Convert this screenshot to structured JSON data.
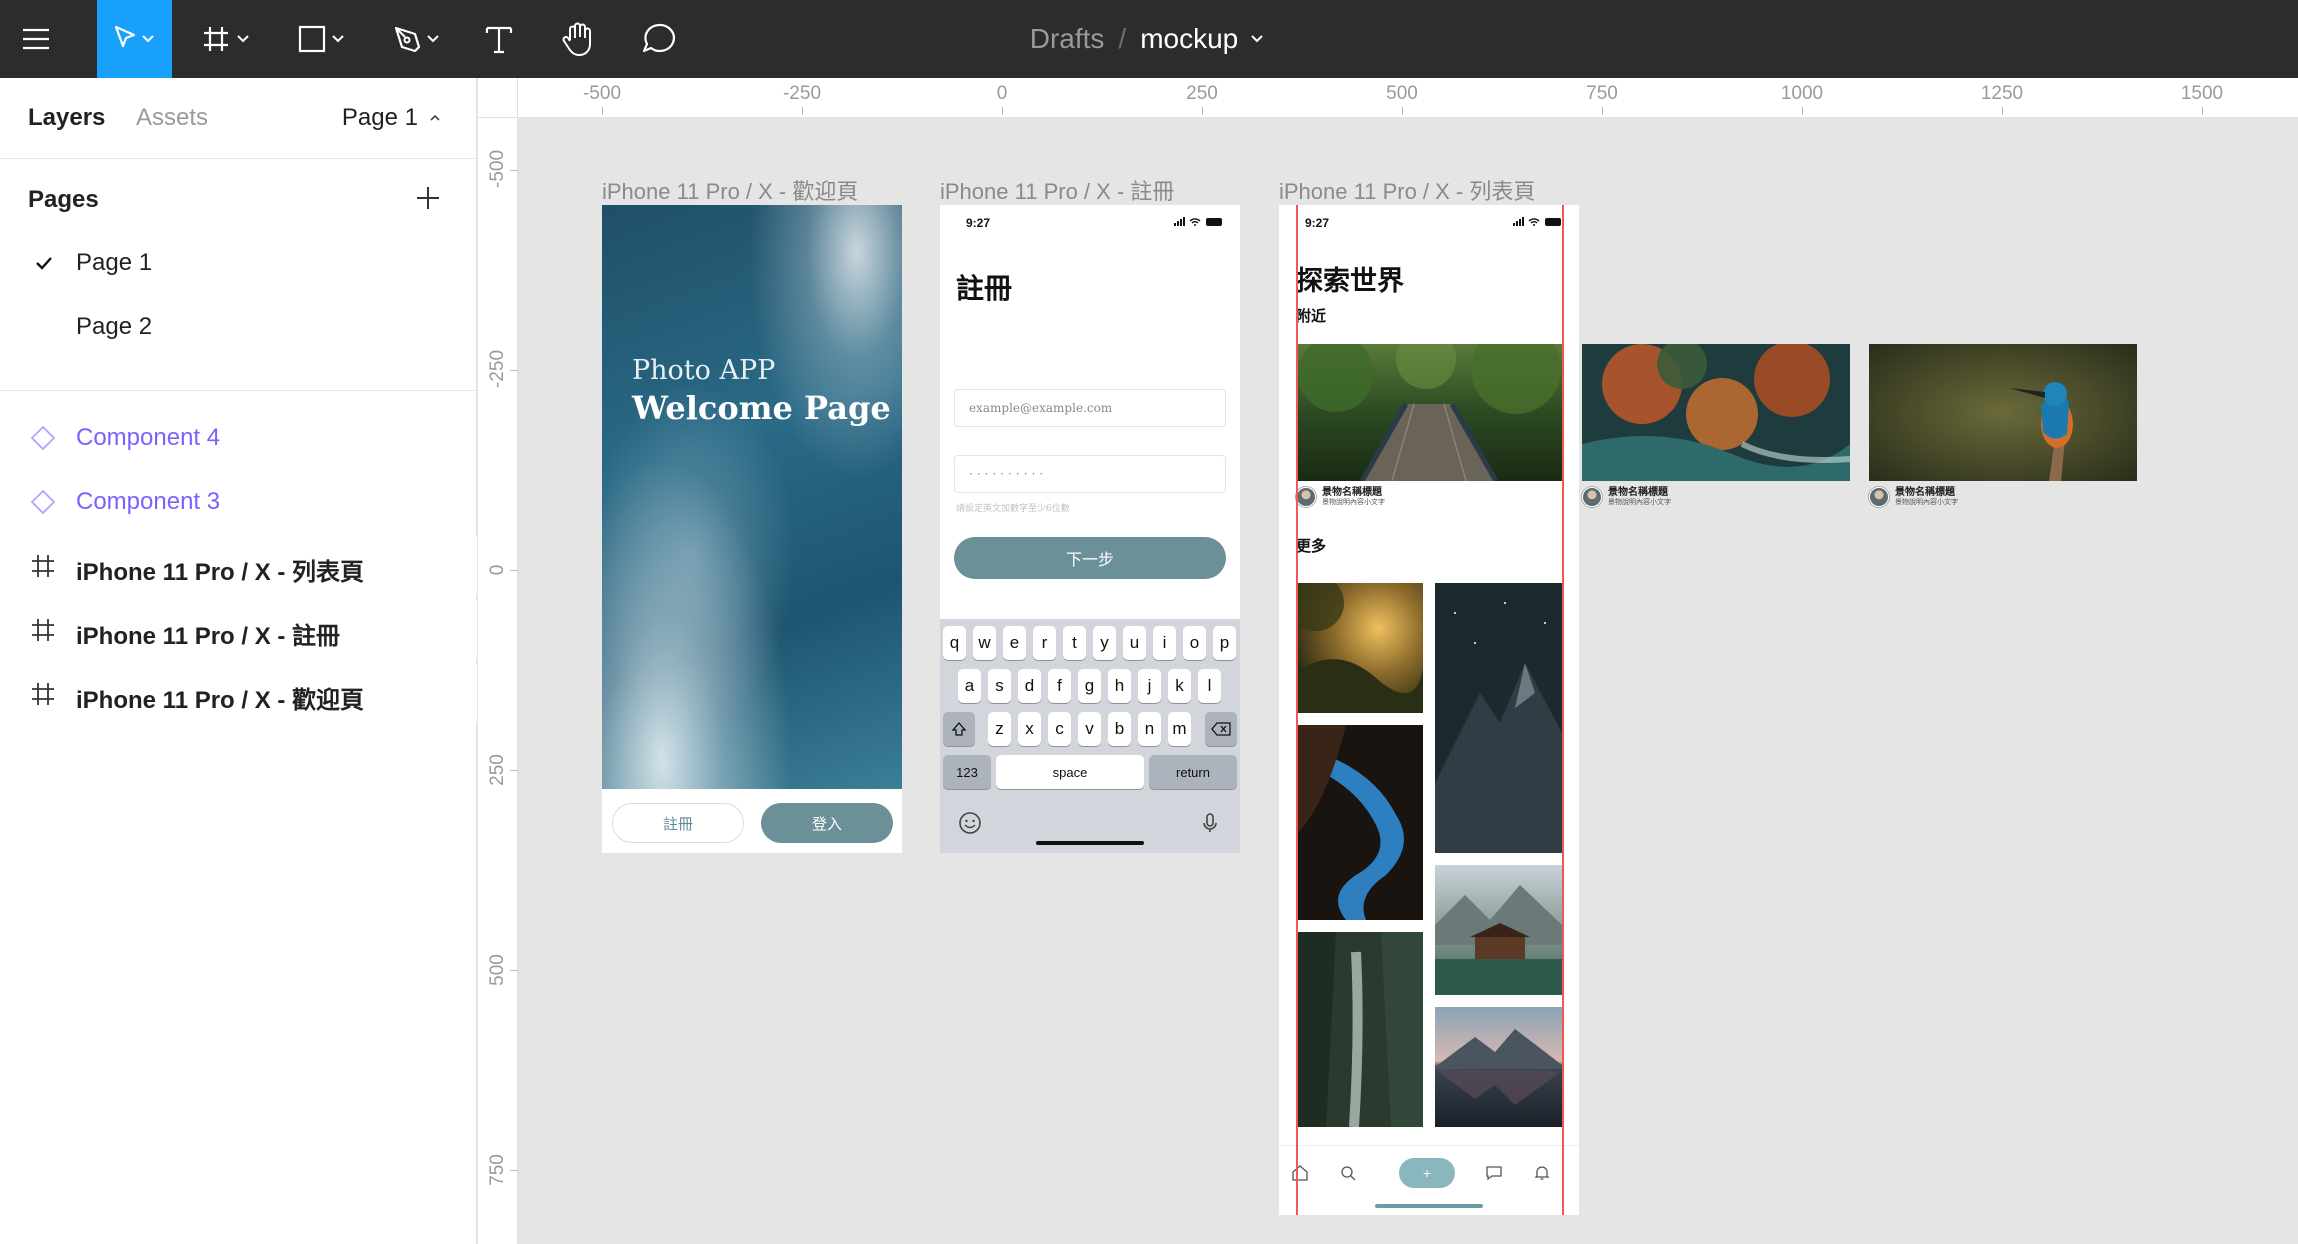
{
  "toolbar": {
    "menu_icon": "hamburger-icon",
    "tools": [
      "move-tool",
      "frame-tool",
      "shape-tool",
      "pen-tool",
      "text-tool",
      "hand-tool",
      "comment-tool"
    ],
    "active_tool": "move-tool",
    "accent": "#18a0fb",
    "breadcrumb_folder": "Drafts",
    "breadcrumb_sep": "/",
    "file_name": "mockup"
  },
  "left_panel": {
    "tab_layers": "Layers",
    "tab_assets": "Assets",
    "current_page": "Page 1",
    "pages_title": "Pages",
    "pages": [
      {
        "label": "Page 1",
        "selected": true
      },
      {
        "label": "Page 2",
        "selected": false
      }
    ],
    "layers": [
      {
        "label": "Component 4",
        "type": "component"
      },
      {
        "label": "Component 3",
        "type": "component"
      },
      {
        "label": "iPhone 11 Pro / X - 列表頁",
        "type": "frame"
      },
      {
        "label": "iPhone 11 Pro / X - 註冊",
        "type": "frame"
      },
      {
        "label": "iPhone 11 Pro / X - 歡迎頁",
        "type": "frame"
      }
    ],
    "component_color": "#7b61ff"
  },
  "rulers": {
    "top": [
      "-500",
      "-250",
      "0",
      "250",
      "500",
      "750",
      "1000",
      "1250",
      "1500"
    ],
    "left": [
      "-500",
      "-250",
      "0",
      "250",
      "500",
      "750"
    ]
  },
  "canvas": {
    "frame_labels": {
      "welcome": "iPhone 11 Pro / X - 歡迎頁",
      "register": "iPhone 11 Pro / X - 註冊",
      "list": "iPhone 11 Pro / X - 列表頁"
    },
    "welcome": {
      "subtitle": "Photo APP",
      "title": "Welcome Page",
      "register_btn": "註冊",
      "login_btn": "登入"
    },
    "register": {
      "time": "9:27",
      "title": "註冊",
      "email_placeholder": "example@example.com",
      "password_mask": "··········",
      "hint": "請設定英文加數字至少6位數",
      "next_btn": "下一步",
      "keyboard": {
        "row1": [
          "q",
          "w",
          "e",
          "r",
          "t",
          "y",
          "u",
          "i",
          "o",
          "p"
        ],
        "row2": [
          "a",
          "s",
          "d",
          "f",
          "g",
          "h",
          "j",
          "k",
          "l"
        ],
        "row3": [
          "z",
          "x",
          "c",
          "v",
          "b",
          "n",
          "m"
        ],
        "num_key": "123",
        "space_key": "space",
        "return_key": "return"
      }
    },
    "list": {
      "time": "9:27",
      "title": "探索世界",
      "nearby": "附近",
      "more": "更多",
      "card_title": "景物名稱標題",
      "card_desc": "景物說明內容小文字",
      "tab_add": "+"
    },
    "guide_color": "#f25757"
  }
}
